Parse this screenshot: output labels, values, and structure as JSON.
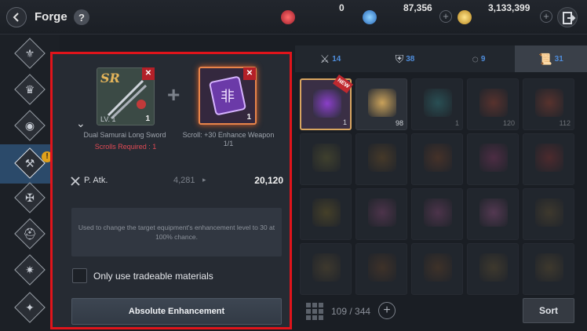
{
  "header": {
    "title": "Forge",
    "help_icon": "?",
    "currencies": [
      {
        "icon": "red-gem-icon",
        "value": "0"
      },
      {
        "icon": "blue-crystal-icon",
        "value": "87,356"
      },
      {
        "icon": "gold-coin-icon",
        "value": "3,133,399"
      }
    ]
  },
  "left_nav": {
    "items": [
      "guild-crest-icon",
      "crown-icon",
      "orb-icon",
      "forge-icon",
      "cross-icon",
      "skull-icon",
      "helmet-icon",
      "spike-icon",
      "star-icon"
    ],
    "active_index": 3,
    "alert": "!"
  },
  "enhance_panel": {
    "target": {
      "grade": "SR",
      "level": "LV. 1",
      "quantity": "1",
      "close": "✕",
      "name": "Dual Samurai Long Sword",
      "requirement": "Scrolls Required : 1"
    },
    "plus": "+",
    "material": {
      "quantity": "1",
      "close": "✕",
      "name": "Scroll: +30 Enhance Weapon",
      "count": "1/1"
    },
    "stat": {
      "name": "P. Atk.",
      "old_value": "4,281",
      "arrow": "▸",
      "new_value": "20,120"
    },
    "description": "Used to change the target equipment's enhancement level to 30 at 100% chance.",
    "option_label": "Only use tradeable materials",
    "action_label": "Absolute Enhancement"
  },
  "inventory": {
    "tabs": [
      {
        "icon": "crossed-swords-icon",
        "count": "14"
      },
      {
        "icon": "armor-icon",
        "count": "38"
      },
      {
        "icon": "ring-icon",
        "count": "9"
      },
      {
        "icon": "scroll-icon",
        "count": "31"
      }
    ],
    "active_tab": 3,
    "items": [
      {
        "qty": "1",
        "new": "NEW",
        "color": "#8a3fc8"
      },
      {
        "qty": "98",
        "color": "#c9a15a"
      },
      {
        "qty": "1",
        "color": "#3c8b8f"
      },
      {
        "qty": "120",
        "color": "#a24b3a"
      },
      {
        "qty": "112",
        "color": "#a24b3a"
      },
      {
        "qty": "",
        "color": "#6d6a3a"
      },
      {
        "qty": "",
        "color": "#7a5a30"
      },
      {
        "qty": "",
        "color": "#7a4a30"
      },
      {
        "qty": "",
        "color": "#8a3f6a"
      },
      {
        "qty": "",
        "color": "#8a3a3a"
      },
      {
        "qty": "",
        "color": "#7a6a30"
      },
      {
        "qty": "",
        "color": "#8a4f7a"
      },
      {
        "qty": "",
        "color": "#8a4f7a"
      },
      {
        "qty": "",
        "color": "#9a5a8a"
      },
      {
        "qty": "",
        "color": "#6a5a3a"
      },
      {
        "qty": "",
        "color": "#6a5a3a"
      },
      {
        "qty": "",
        "color": "#6a4a30"
      },
      {
        "qty": "",
        "color": "#6a4a30"
      },
      {
        "qty": "",
        "color": "#6a5a3a"
      },
      {
        "qty": "",
        "color": "#6a5a3a"
      }
    ],
    "capacity": "109 / 344",
    "expand": "+",
    "sort_label": "Sort"
  }
}
